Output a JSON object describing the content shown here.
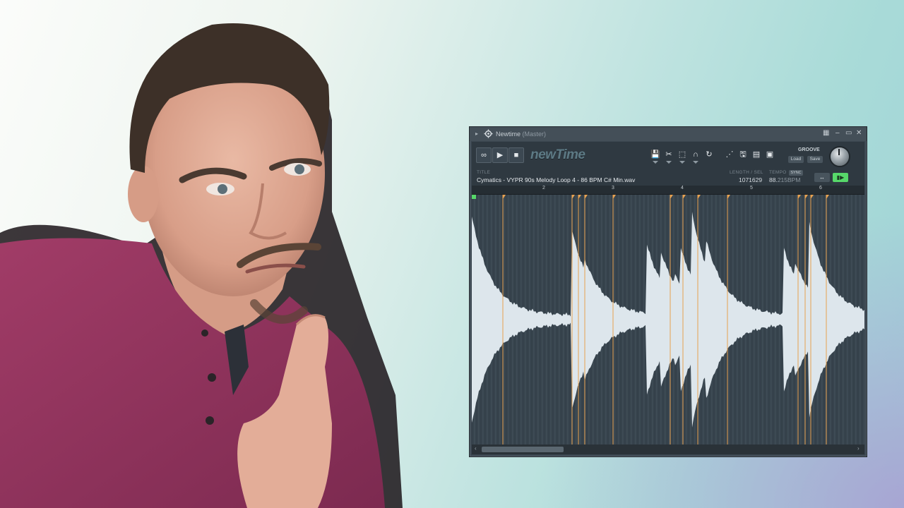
{
  "window": {
    "title": "Newtime",
    "subtitle": "(Master)"
  },
  "toolbar": {
    "loop_label": "∞",
    "play_label": "▶",
    "stop_label": "■",
    "logo_text": "newTime",
    "groove_label": "GROOVE",
    "load_label": "Load",
    "save_label": "Save"
  },
  "info": {
    "title_label": "TITLE",
    "filename": "Cymatics - VYPR 90s Melody Loop 4 - 86 BPM C# Min.wav",
    "length_label": "LENGTH / SEL",
    "length_value": "1071629",
    "tempo_label": "TEMPO",
    "tempo_main": "88.",
    "tempo_dec": "215BPM",
    "sync_label": "SYNC"
  },
  "ruler": {
    "bars": [
      "2",
      "3",
      "4",
      "5",
      "6"
    ]
  },
  "colors": {
    "accent_green": "#57d86a",
    "marker_orange": "#e8a251",
    "waveform": "#dde6ec"
  },
  "icons": [
    "gear-icon",
    "save-icon",
    "cut-icon",
    "select-icon",
    "magnet-icon",
    "undo-icon",
    "curve-icon",
    "export-icon",
    "file-icon",
    "slice-icon",
    "link-icon",
    "play-marker-icon"
  ]
}
